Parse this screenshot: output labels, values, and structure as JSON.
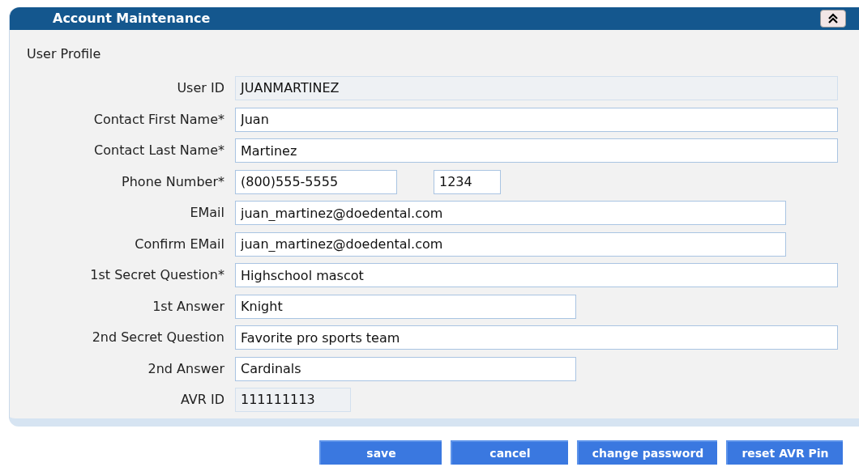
{
  "panel": {
    "title": "Account Maintenance"
  },
  "section": "User Profile",
  "fields": [
    {
      "label": "User ID",
      "kind": "readonly",
      "value": "JUANMARTINEZ"
    },
    {
      "label": "Contact First Name*",
      "kind": "wide",
      "value": "Juan"
    },
    {
      "label": "Contact Last Name*",
      "kind": "wide",
      "value": "Martinez"
    },
    {
      "label": "Phone Number*",
      "kind": "phone",
      "value": "(800)555-5555",
      "extension": "1234"
    },
    {
      "label": "EMail",
      "kind": "medium",
      "value": "juan_martinez@doedental.com"
    },
    {
      "label": "Confirm EMail",
      "kind": "medium",
      "value": "juan_martinez@doedental.com"
    },
    {
      "label": "1st Secret Question*",
      "kind": "wide",
      "value": "Highschool mascot"
    },
    {
      "label": "1st Answer",
      "kind": "narrow",
      "value": "Knight"
    },
    {
      "label": "2nd Secret Question",
      "kind": "wide",
      "value": "Favorite pro sports team"
    },
    {
      "label": "2nd Answer",
      "kind": "narrow",
      "value": "Cardinals"
    },
    {
      "label": "AVR ID",
      "kind": "readonly-short",
      "value": "111111113"
    }
  ],
  "buttons": [
    "save",
    "cancel",
    "change password",
    "reset AVR Pin"
  ]
}
